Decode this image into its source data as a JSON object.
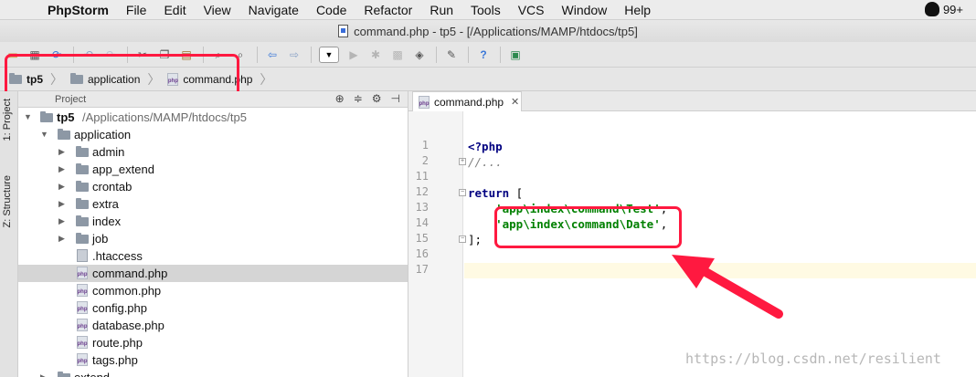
{
  "menubar": {
    "apple_glyph": "",
    "app_name": "PhpStorm",
    "items": [
      "File",
      "Edit",
      "View",
      "Navigate",
      "Code",
      "Refactor",
      "Run",
      "Tools",
      "VCS",
      "Window",
      "Help"
    ],
    "badge": "99+"
  },
  "window": {
    "title": "command.php - tp5 - [/Applications/MAMP/htdocs/tp5]"
  },
  "breadcrumb": {
    "items": [
      "tp5",
      "application",
      "command.php"
    ],
    "php_badge": "php"
  },
  "tool_windows": {
    "project_tab": "1: Project",
    "structure_tab": "Z: Structure"
  },
  "project_panel": {
    "header": "Project",
    "tree": [
      {
        "label": "tp5",
        "path": "/Applications/MAMP/htdocs/tp5"
      },
      {
        "label": "application"
      },
      {
        "label": "admin"
      },
      {
        "label": "app_extend"
      },
      {
        "label": "crontab"
      },
      {
        "label": "extra"
      },
      {
        "label": "index"
      },
      {
        "label": "job"
      },
      {
        "label": ".htaccess"
      },
      {
        "label": "command.php"
      },
      {
        "label": "common.php"
      },
      {
        "label": "config.php"
      },
      {
        "label": "database.php"
      },
      {
        "label": "route.php"
      },
      {
        "label": "tags.php"
      },
      {
        "label": "extend"
      }
    ]
  },
  "editor": {
    "tab_label": "command.php",
    "line_numbers": [
      "1",
      "2",
      "11",
      "12",
      "13",
      "14",
      "15",
      "16",
      "17"
    ],
    "code": {
      "l1": "<?php",
      "l2": "//...",
      "l12_kw": "return",
      "l12_rest": " [",
      "l13_str": "'app\\index\\command\\Test'",
      "l13_rest": ",",
      "l14_str": "'app\\index\\command\\Date'",
      "l14_rest": ",",
      "l15": "];"
    }
  },
  "watermark": "https://blog.csdn.net/resilient",
  "colors": {
    "annotation_red": "#ff1940",
    "keyword": "#000080",
    "string": "#008000",
    "comment": "#808080"
  }
}
